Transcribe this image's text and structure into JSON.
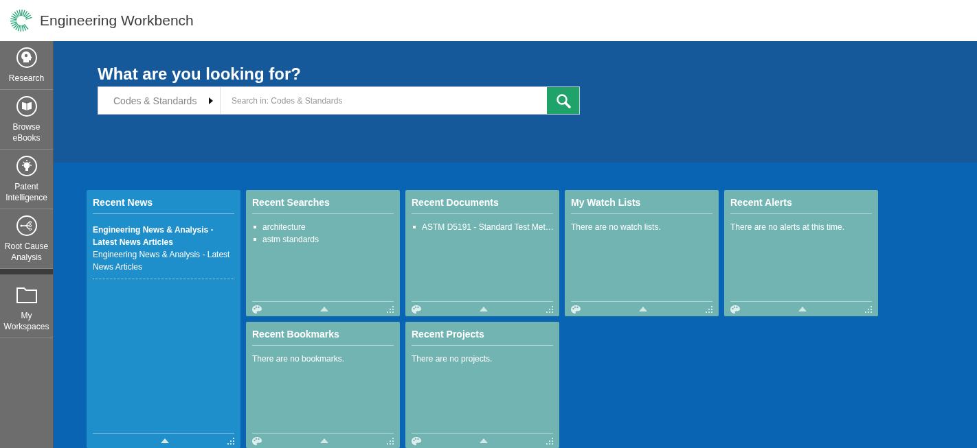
{
  "header": {
    "title": "Engineering Workbench"
  },
  "sidebar": {
    "items": [
      {
        "label": "Research"
      },
      {
        "label": "Browse eBooks"
      },
      {
        "label": "Patent Intelligence"
      },
      {
        "label": "Root Cause Analysis"
      },
      {
        "label": "My Workspaces"
      }
    ]
  },
  "search": {
    "heading": "What are you looking for?",
    "scope": "Codes & Standards",
    "placeholder": "Search in: Codes & Standards"
  },
  "widgets": [
    {
      "title": "Recent News",
      "kind": "news",
      "color": "#1e8fca",
      "headline": "Engineering News & Analysis - Latest News Articles",
      "summary": "Engineering News & Analysis - Latest News Articles"
    },
    {
      "title": "Recent Searches",
      "kind": "list",
      "color": "#72b4b2",
      "items": [
        "architecture",
        "astm standards"
      ]
    },
    {
      "title": "Recent Documents",
      "kind": "list",
      "color": "#72b4b2",
      "items": [
        "ASTM D5191 - Standard Test Met…"
      ]
    },
    {
      "title": "My Watch Lists",
      "kind": "message",
      "color": "#72b4b2",
      "message": "There are no watch lists."
    },
    {
      "title": "Recent Alerts",
      "kind": "message",
      "color": "#72b4b2",
      "message": "There are no alerts at this time."
    },
    {
      "title": "Recent Bookmarks",
      "kind": "message",
      "color": "#72b4b2",
      "message": "There are no bookmarks."
    },
    {
      "title": "Recent Projects",
      "kind": "message",
      "color": "#72b4b2",
      "message": "There are no projects."
    }
  ]
}
